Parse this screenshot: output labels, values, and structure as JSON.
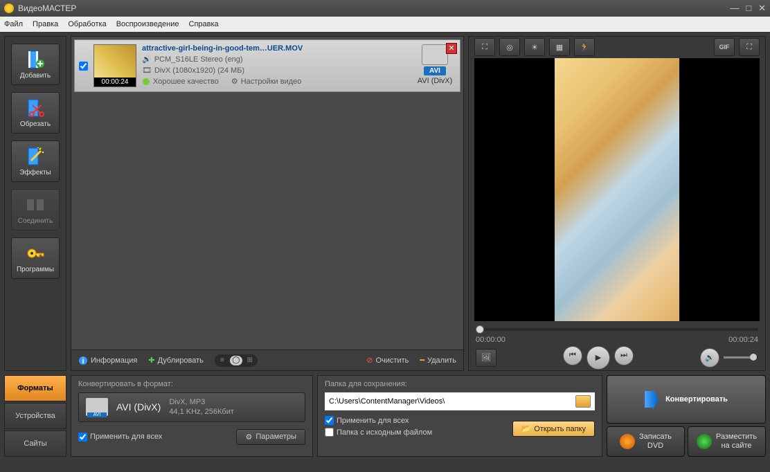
{
  "title": "ВидеоМАСТЕР",
  "menu": {
    "file": "Файл",
    "edit": "Правка",
    "process": "Обработка",
    "playback": "Воспроизведение",
    "help": "Справка"
  },
  "tools": {
    "add": "Добавить",
    "cut": "Обрезать",
    "effects": "Эффекты",
    "join": "Соединить",
    "programs": "Программы"
  },
  "file": {
    "name": "attractive-girl-being-in-good-tem…UER.MOV",
    "audio": "PCM_S16LE Stereo (eng)",
    "video": "DivX (1080x1920) (24 МБ)",
    "quality": "Хорошее качество",
    "settings": "Настройки видео",
    "duration": "00:00:24",
    "out_badge": "AVI",
    "out_codec": "AVI (DivX)"
  },
  "listbar": {
    "info": "Информация",
    "dup": "Дублировать",
    "clear": "Очистить",
    "delete": "Удалить"
  },
  "preview": {
    "t_start": "00:00:00",
    "t_end": "00:00:24",
    "gif": "GIF"
  },
  "tabs": {
    "formats": "Форматы",
    "devices": "Устройства",
    "sites": "Сайты"
  },
  "convert": {
    "hdr": "Конвертировать в формат:",
    "fmt": "AVI (DivX)",
    "codec1": "DivX, MP3",
    "codec2": "44,1 KHz, 256Кбит",
    "apply_all": "Применить для всех",
    "params": "Параметры"
  },
  "save": {
    "hdr": "Папка для сохранения:",
    "path": "C:\\Users\\ContentManager\\Videos\\",
    "apply_all": "Применить для всех",
    "same_folder": "Папка с исходным файлом",
    "open": "Открыть папку"
  },
  "actions": {
    "convert": "Конвертировать",
    "dvd1": "Записать",
    "dvd2": "DVD",
    "web1": "Разместить",
    "web2": "на сайте"
  }
}
